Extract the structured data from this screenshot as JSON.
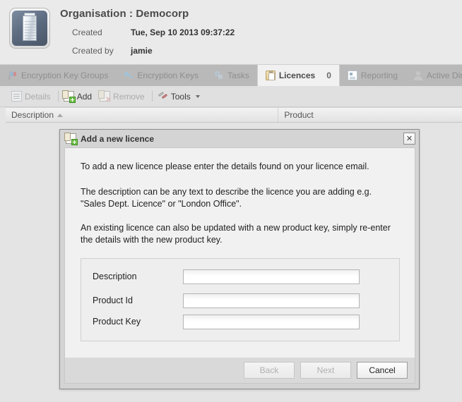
{
  "header": {
    "org_icon": "building-icon",
    "title": "Organisation : Democorp",
    "created_label": "Created",
    "created_value": "Tue, Sep 10 2013 09:37:22",
    "created_by_label": "Created by",
    "created_by_value": "jamie"
  },
  "tabs": [
    {
      "label": "Encryption Key Groups",
      "icon": "flag-icon",
      "active": false
    },
    {
      "label": "Encryption Keys",
      "icon": "key-icon",
      "active": false
    },
    {
      "label": "Tasks",
      "icon": "gears-icon",
      "active": false
    },
    {
      "label": "Licences",
      "icon": "clipboard-icon",
      "active": true,
      "count": "0"
    },
    {
      "label": "Reporting",
      "icon": "report-icon",
      "active": false
    },
    {
      "label": "Active Direc",
      "icon": "person-icon",
      "active": false
    }
  ],
  "toolbar": {
    "details_label": "Details",
    "add_label": "Add",
    "remove_label": "Remove",
    "tools_label": "Tools"
  },
  "grid": {
    "columns": [
      {
        "label": "Description",
        "sort": "ascending"
      },
      {
        "label": "Product",
        "sort": ""
      }
    ],
    "rows": []
  },
  "dialog": {
    "title": "Add a new licence",
    "title_icon": "add-document-icon",
    "close_icon": "close-icon",
    "close_label": "✕",
    "paragraphs": [
      "To add a new licence please enter the details found on your licence email.",
      "The description can be any text to describe the licence you are adding e.g. \"Sales Dept. Licence\" or \"London Office\".",
      "An existing licence can also be updated with a new product key, simply re-enter the details with the new product key."
    ],
    "fields": [
      {
        "label": "Description",
        "value": "",
        "placeholder": ""
      },
      {
        "label": "Product Id",
        "value": "",
        "placeholder": ""
      },
      {
        "label": "Product Key",
        "value": "",
        "placeholder": ""
      }
    ],
    "buttons": [
      {
        "label": "Back",
        "enabled": false
      },
      {
        "label": "Next",
        "enabled": false
      },
      {
        "label": "Cancel",
        "enabled": true
      }
    ]
  },
  "colors": {
    "page_bg": "#e4e4e4",
    "header_bg": "#eaeaea",
    "tabbar_bg": "#b9b9b9",
    "active_tab_bg": "#f1f1f1",
    "toolbar_bg": "#e0e0e0",
    "dialog_chrome": "#d4d4d4",
    "dialog_body": "#f1f1f1",
    "accent_green": "#6fbf47"
  }
}
